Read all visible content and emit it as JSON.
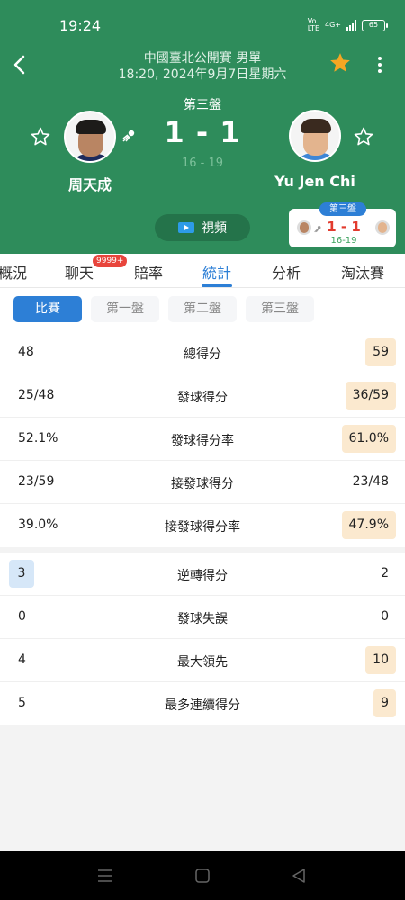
{
  "status_bar": {
    "time": "19:24",
    "network_label": "VoLTE",
    "network_gen": "4G+",
    "battery": "65"
  },
  "header": {
    "match_title": "中國臺北公開賽 男單",
    "match_datetime": "18:20, 2024年9月7日星期六",
    "set_label": "第三盤",
    "score": "1 - 1",
    "set_score": "16 - 19",
    "video_label": "視頻"
  },
  "players": {
    "left": {
      "name": "周天成"
    },
    "right": {
      "name": "Yu Jen Chi"
    }
  },
  "mini_card": {
    "tag": "第三盤",
    "score": "1 - 1",
    "set_score": "16-19"
  },
  "tabs": [
    {
      "label": "概況"
    },
    {
      "label": "聊天",
      "badge": "9999+"
    },
    {
      "label": "賠率"
    },
    {
      "label": "統計",
      "active": true
    },
    {
      "label": "分析"
    },
    {
      "label": "淘汰賽"
    }
  ],
  "subtabs": [
    {
      "label": "比賽",
      "active": true
    },
    {
      "label": "第一盤"
    },
    {
      "label": "第二盤"
    },
    {
      "label": "第三盤"
    }
  ],
  "stats_group1": [
    {
      "label": "總得分",
      "left": "48",
      "right": "59",
      "highlight": "right"
    },
    {
      "label": "發球得分",
      "left": "25/48",
      "right": "36/59",
      "highlight": "right"
    },
    {
      "label": "發球得分率",
      "left": "52.1%",
      "right": "61.0%",
      "highlight": "right"
    },
    {
      "label": "接發球得分",
      "left": "23/59",
      "right": "23/48",
      "highlight": "none"
    },
    {
      "label": "接發球得分率",
      "left": "39.0%",
      "right": "47.9%",
      "highlight": "right"
    }
  ],
  "stats_group2": [
    {
      "label": "逆轉得分",
      "left": "3",
      "right": "2",
      "highlight": "left"
    },
    {
      "label": "發球失誤",
      "left": "0",
      "right": "0",
      "highlight": "none"
    },
    {
      "label": "最大領先",
      "left": "4",
      "right": "10",
      "highlight": "right"
    },
    {
      "label": "最多連續得分",
      "left": "5",
      "right": "9",
      "highlight": "right"
    }
  ],
  "colors": {
    "header_green": "#2e8c5b",
    "accent_blue": "#2d7fd6",
    "highlight_orange": "#fbe9cf",
    "highlight_blue": "#d6e7f8",
    "star_gold": "#f5a623"
  }
}
